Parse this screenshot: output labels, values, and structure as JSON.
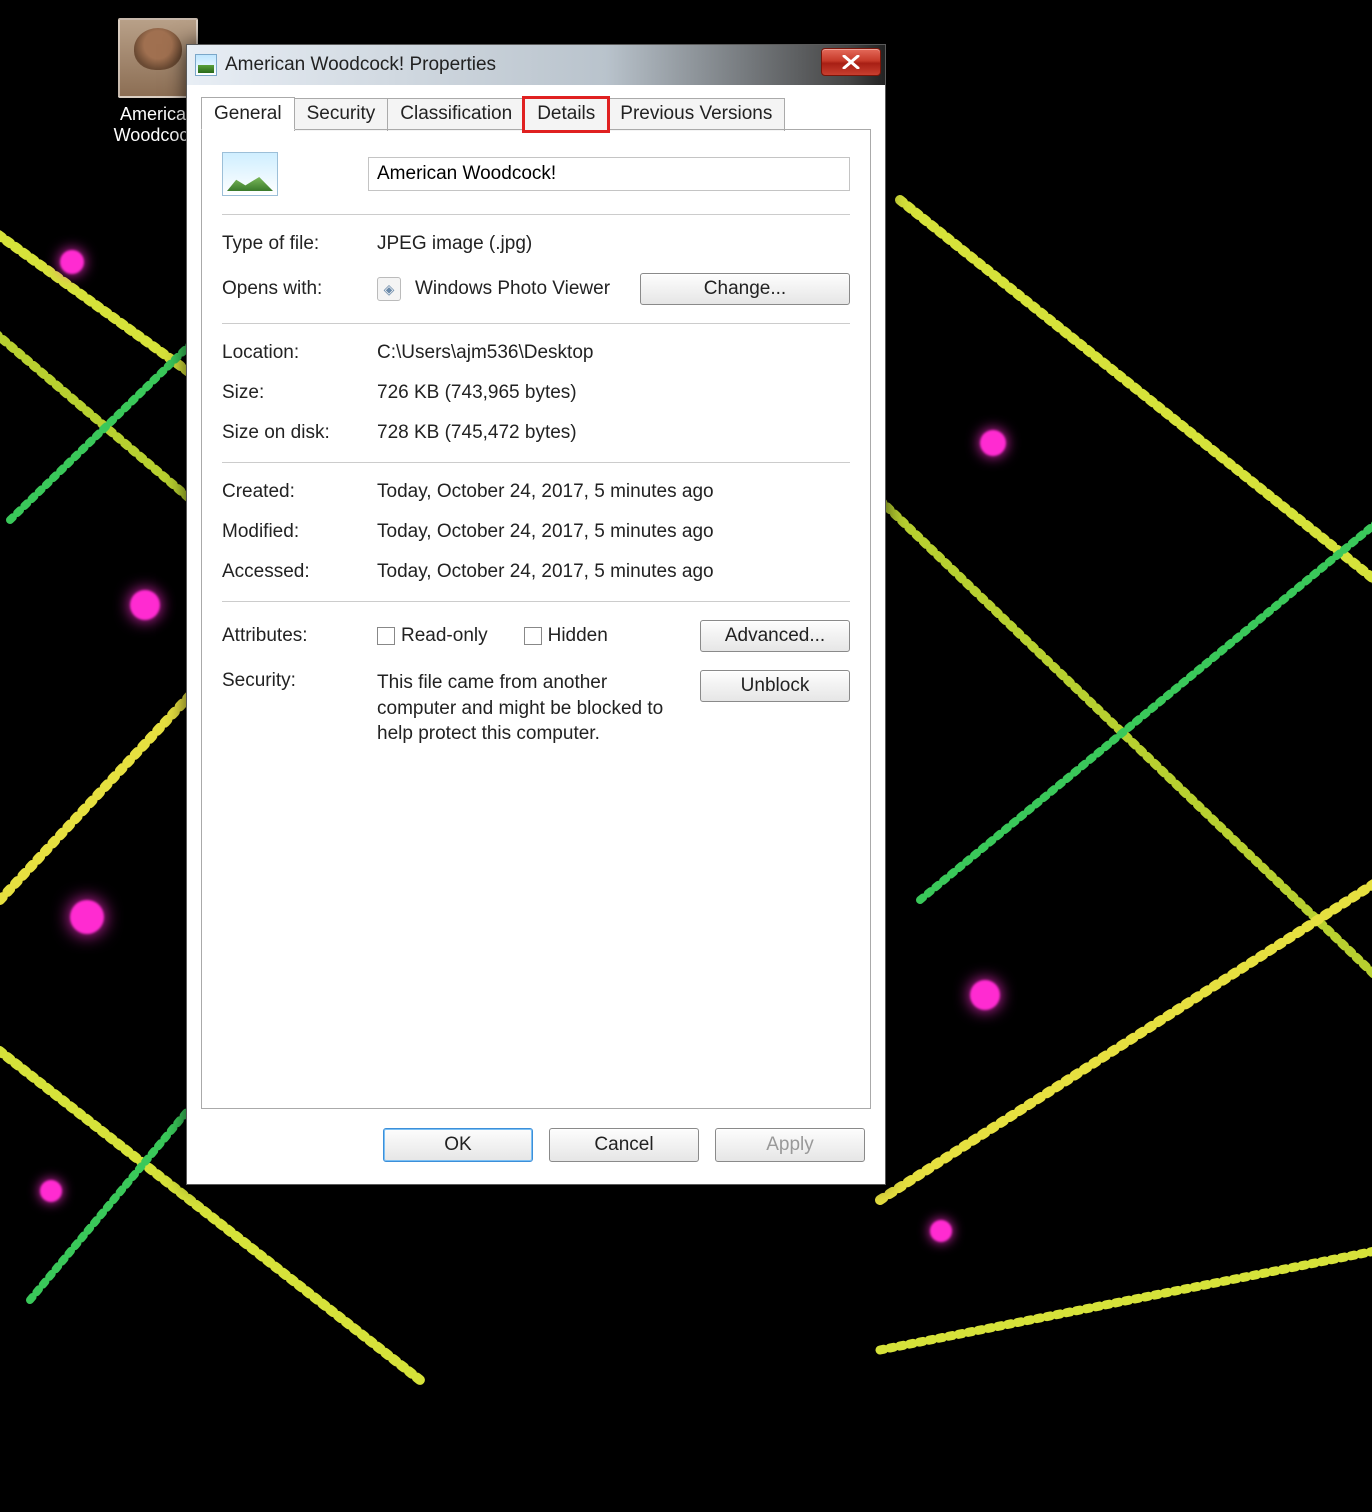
{
  "desktop": {
    "icon_label": "American Woodcock!"
  },
  "dialog": {
    "title": "American Woodcock! Properties",
    "tabs": [
      "General",
      "Security",
      "Classification",
      "Details",
      "Previous Versions"
    ],
    "active_tab_index": 0,
    "highlighted_tab_index": 3,
    "general": {
      "filename": "American Woodcock!",
      "labels": {
        "type": "Type of file:",
        "opens": "Opens with:",
        "location": "Location:",
        "size": "Size:",
        "size_on_disk": "Size on disk:",
        "created": "Created:",
        "modified": "Modified:",
        "accessed": "Accessed:",
        "attributes": "Attributes:",
        "security": "Security:"
      },
      "type_value": "JPEG image (.jpg)",
      "opens_with": "Windows Photo Viewer",
      "change_btn": "Change...",
      "location": "C:\\Users\\ajm536\\Desktop",
      "size": "726 KB (743,965 bytes)",
      "size_on_disk": "728 KB (745,472 bytes)",
      "created": "Today, October 24, 2017, 5 minutes ago",
      "modified": "Today, October 24, 2017, 5 minutes ago",
      "accessed": "Today, October 24, 2017, 5 minutes ago",
      "attr_readonly": "Read-only",
      "attr_hidden": "Hidden",
      "advanced_btn": "Advanced...",
      "security_msg": "This file came from another computer and might be blocked to help protect this computer.",
      "unblock_btn": "Unblock"
    },
    "footer": {
      "ok": "OK",
      "cancel": "Cancel",
      "apply": "Apply"
    }
  }
}
